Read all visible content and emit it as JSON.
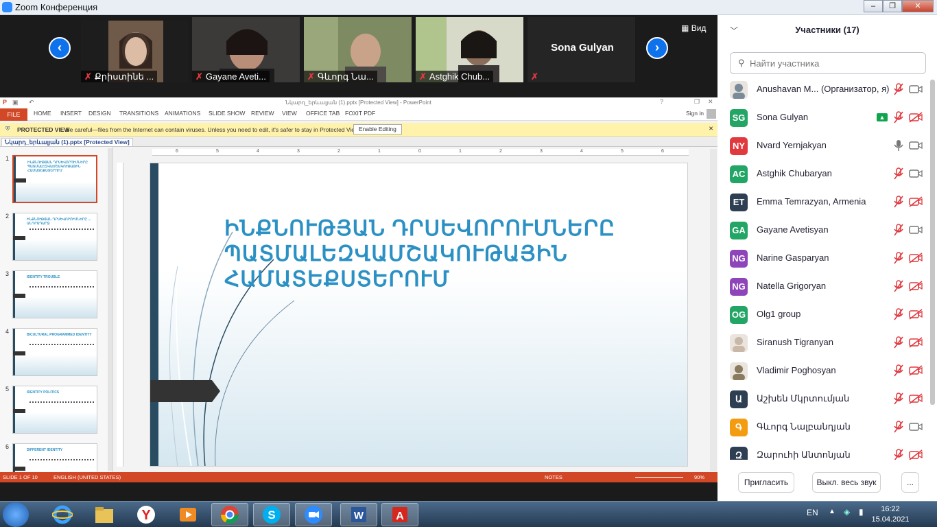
{
  "window": {
    "title": "Zoom Конференция"
  },
  "video_strip": {
    "view_label": "Вид",
    "tiles": [
      {
        "name": "Քրիստինե ...",
        "muted": true
      },
      {
        "name": "Gayane Aveti...",
        "muted": true
      },
      {
        "name": "Գևորգ Նա...",
        "muted": true
      },
      {
        "name": "Astghik Chub...",
        "muted": true
      },
      {
        "name": "Sona Gulyan",
        "muted": true
      }
    ]
  },
  "powerpoint": {
    "window_title": "Նկարդ_երևալյան (1).pptx [Protected View] - PowerPoint",
    "ribbon_tabs": [
      "FILE",
      "HOME",
      "INSERT",
      "DESIGN",
      "TRANSITIONS",
      "ANIMATIONS",
      "SLIDE SHOW",
      "REVIEW",
      "VIEW",
      "OFFICE TAB",
      "FOXIT PDF"
    ],
    "sign_in": "Sign in",
    "protected_view": {
      "label": "PROTECTED VIEW",
      "message": "Be careful—files from the Internet can contain viruses. Unless you need to edit, it's safer to stay in Protected View.",
      "button": "Enable Editing"
    },
    "doc_tab": "Նկարդ_երևալյան (1).pptx [Protected View]",
    "ruler_labels": [
      "6",
      "5",
      "4",
      "3",
      "2",
      "1",
      "0",
      "1",
      "2",
      "3",
      "4",
      "5",
      "6"
    ],
    "thumbnails": [
      {
        "num": "1",
        "title": "ԻՆՔՆՈՒԹՅԱՆ ԴՐՍԵՎՈՐՈՒՄՆԵՐԸ ՊԱՏՄԱԼԵԶՎԱՄՇԱԿՈՒԹԱՅԻՆ ՀԱՄԱՏԵՔՍՏԵՐՈՒՄ"
      },
      {
        "num": "2",
        "title": "ԻՆՔՆՈՒԹՅԱՆ ԴՐՍԵՎՈՐՈՒՄՆԵՐԸ ... ԱՆԴՐԱԴԱՐՁ"
      },
      {
        "num": "3",
        "title": "IDENTITY TROUBLE"
      },
      {
        "num": "4",
        "title": "BICULTURAL PROGRAMMED IDENTITY"
      },
      {
        "num": "5",
        "title": "IDENTITY POLITICS"
      },
      {
        "num": "6",
        "title": "DIFFERENT IDENTITY"
      }
    ],
    "status": {
      "slide": "SLIDE 1 OF 10",
      "language": "ENGLISH (UNITED STATES)",
      "notes": "NOTES",
      "zoom": "90%"
    },
    "slide_title": [
      "ԻՆՔՆՈՒԹՅԱՆ ԴՐՍԵՎՈՐՈՒՄՆԵՐԸ",
      "ՊԱՏՄԱԼԵԶՎԱՄՇԱԿՈՒԹԱՅԻՆ",
      "ՀԱՄԱՏԵՔՍՏԵՐՈՒՄ"
    ]
  },
  "participants": {
    "header": "Участники (17)",
    "search_placeholder": "Найти участника",
    "list": [
      {
        "initials": "",
        "name": "Anushavan M...  (Организатор, я)",
        "color": "#7a8a99",
        "mic": "muted",
        "cam": "on",
        "photo": true
      },
      {
        "initials": "SG",
        "name": "Sona Gulyan",
        "color": "#23a566",
        "mic": "muted",
        "cam": "off",
        "sharing": true
      },
      {
        "initials": "NY",
        "name": "Nvard Yernjakyan",
        "color": "#e0393e",
        "mic": "on",
        "cam": "on"
      },
      {
        "initials": "AC",
        "name": "Astghik Chubaryan",
        "color": "#23a566",
        "mic": "muted",
        "cam": "on"
      },
      {
        "initials": "ET",
        "name": "Emma Temrazyan, Armenia",
        "color": "#2e3e53",
        "mic": "muted",
        "cam": "off"
      },
      {
        "initials": "GA",
        "name": "Gayane Avetisyan",
        "color": "#23a566",
        "mic": "muted",
        "cam": "on"
      },
      {
        "initials": "NG",
        "name": "Narine Gasparyan",
        "color": "#8d45b9",
        "mic": "muted",
        "cam": "off"
      },
      {
        "initials": "NG",
        "name": "Natella Grigoryan",
        "color": "#8d45b9",
        "mic": "muted",
        "cam": "off"
      },
      {
        "initials": "OG",
        "name": "Olg1 group",
        "color": "#23a566",
        "mic": "muted",
        "cam": "off"
      },
      {
        "initials": "",
        "name": "Siranush Tigranyan",
        "color": "#c9b8a8",
        "mic": "muted",
        "cam": "off",
        "photo": true
      },
      {
        "initials": "",
        "name": "Vladimir Poghosyan",
        "color": "#8a7a60",
        "mic": "muted",
        "cam": "off",
        "photo": true
      },
      {
        "initials": "Ա",
        "name": "Աշխեն Մկրտումյան",
        "color": "#2e3e53",
        "mic": "muted",
        "cam": "off"
      },
      {
        "initials": "Գ",
        "name": "Գևորգ Նալբանդյան",
        "color": "#f39c12",
        "mic": "muted",
        "cam": "on"
      },
      {
        "initials": "Զ",
        "name": "Զարուհի Անտոնյան",
        "color": "#2e3e53",
        "mic": "muted",
        "cam": "off"
      }
    ],
    "buttons": {
      "invite": "Пригласить",
      "mute_all": "Выкл. весь звук",
      "more": "..."
    }
  },
  "taskbar": {
    "lang": "EN",
    "time": "16:22",
    "date": "15.04.2021"
  },
  "colors": {
    "zoom_blue": "#0e72ed",
    "ppt_orange": "#d24726",
    "slide_title": "#2b91c4",
    "muted_red": "#e0393e"
  }
}
